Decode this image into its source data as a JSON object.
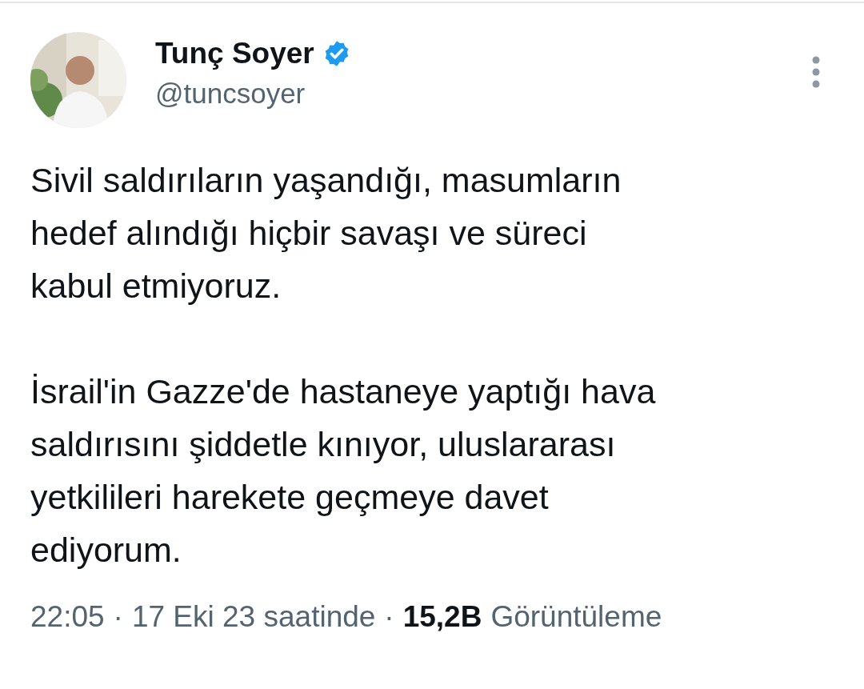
{
  "author": {
    "name": "Tunç Soyer",
    "handle": "@tuncsoyer",
    "verified": true
  },
  "paragraphs": [
    "Sivil saldırıların yaşandığı, masumların\nhedef alındığı hiçbir savaşı ve süreci\nkabul etmiyoruz.",
    "İsrail'in Gazze'de hastaneye yaptığı hava\nsaldırısını şiddetle kınıyor, uluslararası\nyetkilileri harekete geçmeye davet\nediyorum."
  ],
  "footer": {
    "time": "22:05",
    "separator_1": "·",
    "date": "17 Eki 23 saatinde",
    "separator_2": "·",
    "views_count": "15,2B",
    "views_label": "Görüntüleme"
  }
}
